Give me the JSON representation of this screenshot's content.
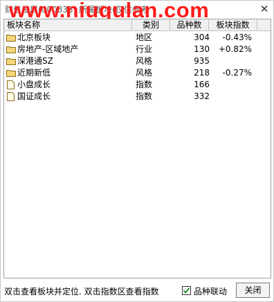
{
  "window": {
    "title": "财信发展(000838)   所属板块(仅供参考",
    "watermark": "www.niugulan.com",
    "close_glyph": "✕"
  },
  "table": {
    "columns": [
      "板块名称",
      "类别",
      "品种数",
      "板块指数"
    ],
    "rows": [
      {
        "name": "北京板块",
        "category": "地区",
        "count": "304",
        "index": "-0.43%",
        "icon": "folder-icon"
      },
      {
        "name": "房地产-区域地产",
        "category": "行业",
        "count": "130",
        "index": "+0.82%",
        "icon": "folder-icon"
      },
      {
        "name": "深港通SZ",
        "category": "风格",
        "count": "935",
        "index": "",
        "icon": "folder-icon"
      },
      {
        "name": "近期新低",
        "category": "风格",
        "count": "218",
        "index": "-0.27%",
        "icon": "folder-icon"
      },
      {
        "name": "小盘成长",
        "category": "指数",
        "count": "166",
        "index": "",
        "icon": "document-icon"
      },
      {
        "name": "国证成长",
        "category": "指数",
        "count": "332",
        "index": "",
        "icon": "document-icon"
      }
    ]
  },
  "footer": {
    "hint": "双击查看板块并定位. 双击指数区查看指数",
    "checkbox_label": "品种联动",
    "checkbox_checked": true,
    "close_button": "关闭"
  },
  "colors": {
    "watermark": "#ff1c1c",
    "folder": "#f5d67a",
    "checkmark": "#1a8a1a"
  }
}
